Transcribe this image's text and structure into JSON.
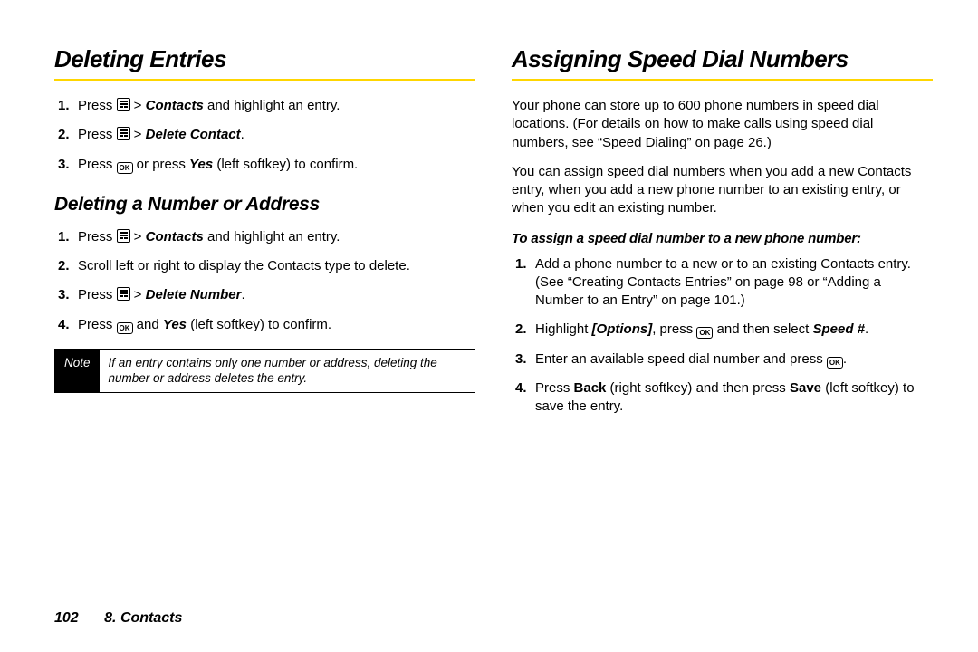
{
  "left": {
    "h1": "Deleting Entries",
    "list1": {
      "i1": {
        "pre": "Press ",
        "post1": " > ",
        "bold1": "Contacts",
        "post2": " and highlight an entry."
      },
      "i2": {
        "pre": "Press ",
        "post1": " > ",
        "bold1": "Delete Contact",
        "post2": "."
      },
      "i3": {
        "pre": "Press ",
        "mid": " or press ",
        "bold1": "Yes",
        "post": " (left softkey) to confirm."
      }
    },
    "h2": "Deleting a Number or Address",
    "list2": {
      "i1": {
        "pre": "Press ",
        "post1": " > ",
        "bold1": "Contacts",
        "post2": " and highlight an entry."
      },
      "i2": "Scroll left or right to display the Contacts type to delete.",
      "i3": {
        "pre": "Press ",
        "post": " > ",
        "bold1": "Delete Number",
        "end": "."
      },
      "i4": {
        "pre": "Press ",
        "mid": " and ",
        "bold1": "Yes",
        "post": " (left softkey) to confirm."
      }
    },
    "note": {
      "label": "Note",
      "text": "If an entry contains only one number or address, deleting the number or address deletes the entry."
    }
  },
  "right": {
    "h1": "Assigning Speed Dial Numbers",
    "p1": "Your phone can store up to 600 phone numbers in speed dial locations. (For details on how to make calls using speed dial numbers, see “Speed Dialing” on page 26.)",
    "p2": "You can assign speed dial numbers when you add a new Contacts entry, when you add a new phone number to an existing entry, or when you edit an existing number.",
    "lead": "To assign a speed dial number to a new phone number:",
    "list": {
      "i1": "Add a phone number to a new or to an existing Contacts entry. (See “Creating Contacts Entries” on page 98 or “Adding a Number to an Entry” on page 101.)",
      "i2": {
        "pre": "Highlight ",
        "bold1": "[Options]",
        "mid": ", press ",
        "post": " and then select ",
        "bold2": "Speed #",
        "end": "."
      },
      "i3": {
        "pre": "Enter an available speed dial number and press ",
        "end": "."
      },
      "i4": {
        "pre": "Press ",
        "bold1": "Back",
        "mid": " (right softkey) and then press ",
        "bold2": "Save",
        "post": " (left softkey) to save the entry."
      }
    }
  },
  "footer": {
    "page": "102",
    "section": "8. Contacts"
  },
  "icons": {
    "ok": "OK"
  }
}
